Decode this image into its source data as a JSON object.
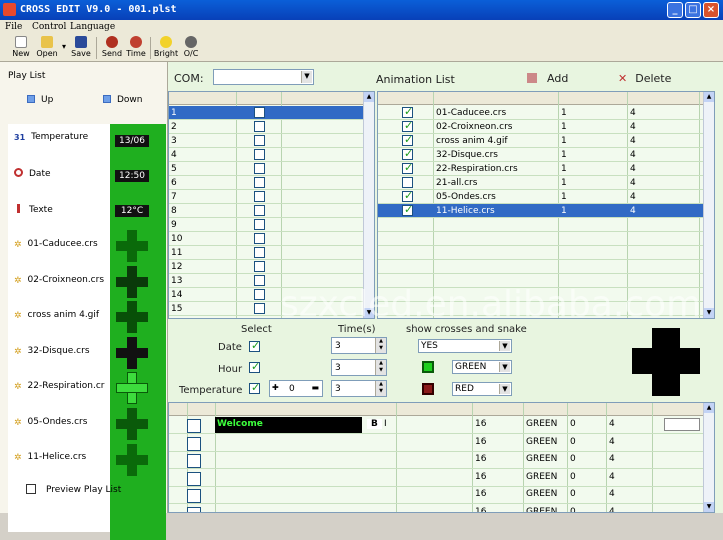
{
  "window": {
    "title": "CROSS EDIT V9.0 - 001.plst",
    "minimize": "_",
    "maximize": "□",
    "close": "×"
  },
  "menu": {
    "file": "File",
    "control": "Control",
    "language": "Language"
  },
  "toolbar": {
    "new": "New",
    "open": "Open",
    "save": "Save",
    "send": "Send",
    "time": "Time",
    "bright": "Bright",
    "oc": "O/C"
  },
  "playlist": {
    "title": "Play List",
    "up": "Up",
    "down": "Down",
    "items": [
      {
        "label": "Temperature",
        "icon": "calendar-icon",
        "thumb": "13/06"
      },
      {
        "label": "Date",
        "icon": "clock-icon",
        "thumb": "12:50"
      },
      {
        "label": "Texte",
        "icon": "thermometer-icon",
        "thumb": "12°C"
      },
      {
        "label": "01-Caducee.crs",
        "icon": "star-icon"
      },
      {
        "label": "02-Croixneon.crs",
        "icon": "star-icon"
      },
      {
        "label": "cross anim 4.gif",
        "icon": "star-icon"
      },
      {
        "label": "32-Disque.crs",
        "icon": "star-icon"
      },
      {
        "label": "22-Respiration.cr",
        "icon": "star-icon"
      },
      {
        "label": "05-Ondes.crs",
        "icon": "star-icon"
      },
      {
        "label": "11-Helice.crs",
        "icon": "star-icon"
      }
    ],
    "preview": "Preview Play List"
  },
  "com": {
    "label": "COM:",
    "value": ""
  },
  "index_grid": {
    "rows": [
      "1",
      "2",
      "3",
      "4",
      "5",
      "6",
      "7",
      "8",
      "9",
      "10",
      "11",
      "12",
      "13",
      "14",
      "15"
    ],
    "selected": 0
  },
  "animation": {
    "title": "Animation List",
    "add": "Add",
    "delete": "Delete",
    "rows": [
      {
        "name": "01-Caducee.crs",
        "a": "1",
        "b": "4",
        "checked": true
      },
      {
        "name": "02-Croixneon.crs",
        "a": "1",
        "b": "4",
        "checked": true
      },
      {
        "name": "cross anim 4.gif",
        "a": "1",
        "b": "4",
        "checked": true
      },
      {
        "name": "32-Disque.crs",
        "a": "1",
        "b": "4",
        "checked": true
      },
      {
        "name": "22-Respiration.crs",
        "a": "1",
        "b": "4",
        "checked": true
      },
      {
        "name": "21-all.crs",
        "a": "1",
        "b": "4",
        "checked": false
      },
      {
        "name": "05-Ondes.crs",
        "a": "1",
        "b": "4",
        "checked": true
      },
      {
        "name": "11-Helice.crs",
        "a": "1",
        "b": "4",
        "checked": true
      }
    ],
    "selected": 7
  },
  "settings": {
    "select_label": "Select",
    "time_label": "Time(s)",
    "show_label": "show crosses and snake",
    "date_label": "Date",
    "hour_label": "Hour",
    "temp_label": "Temperature",
    "date_time": "3",
    "hour_time": "3",
    "temp_time": "3",
    "temp_offset": "0",
    "show_value": "YES",
    "cross_color": "GREEN",
    "snake_color": "RED"
  },
  "text_grid": {
    "rows": [
      {
        "text": "Welcome",
        "bold": "B",
        "italic": "I",
        "size": "16",
        "color": "GREEN",
        "a": "0",
        "b": "4"
      },
      {
        "text": "",
        "size": "16",
        "color": "GREEN",
        "a": "0",
        "b": "4"
      },
      {
        "text": "",
        "size": "16",
        "color": "GREEN",
        "a": "0",
        "b": "4"
      },
      {
        "text": "",
        "size": "16",
        "color": "GREEN",
        "a": "0",
        "b": "4"
      },
      {
        "text": "",
        "size": "16",
        "color": "GREEN",
        "a": "0",
        "b": "4"
      },
      {
        "text": "",
        "size": "16",
        "color": "GREEN",
        "a": "0",
        "b": "4"
      }
    ]
  },
  "watermark": "szxcled.en.alibaba.com",
  "colors": {
    "title_bar": "#0a5fd8",
    "panel_green": "#1faf1f",
    "selection": "#316ac5",
    "grid_bg": "#e8f5e0"
  }
}
